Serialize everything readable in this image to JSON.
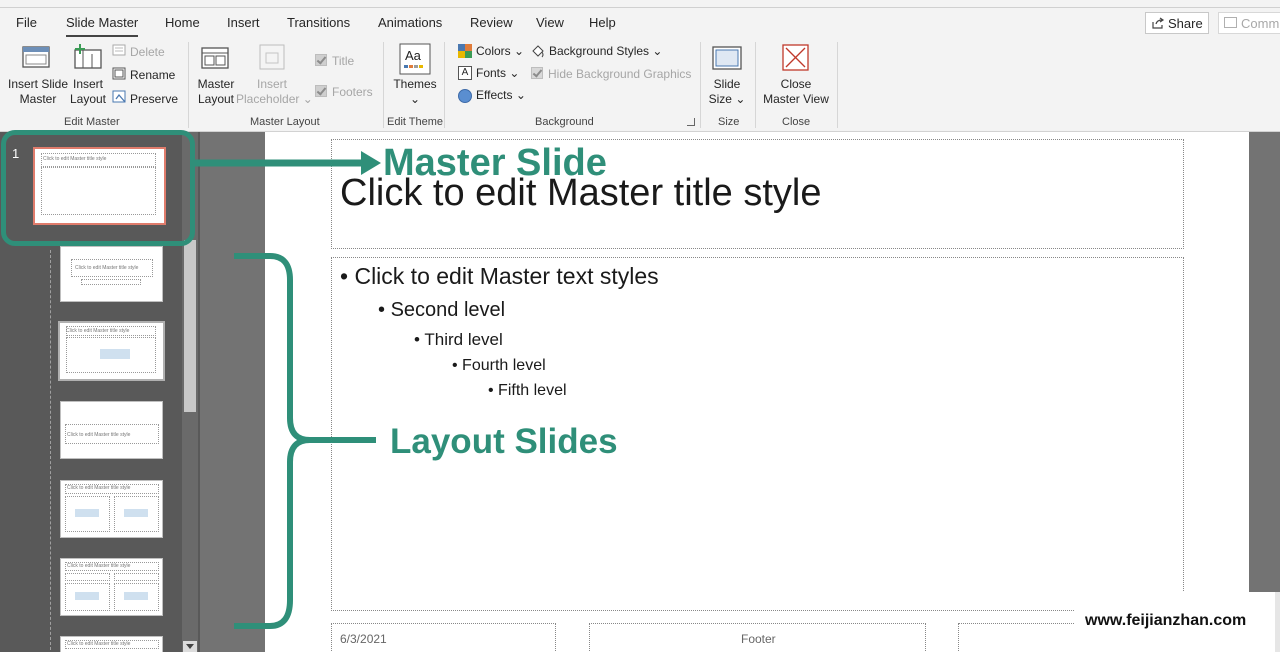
{
  "menu": {
    "tabs": [
      "File",
      "Slide Master",
      "Home",
      "Insert",
      "Transitions",
      "Animations",
      "Review",
      "View",
      "Help"
    ],
    "active_tab": "Slide Master",
    "share_label": "Share",
    "comments_label": "Comm"
  },
  "ribbon": {
    "insert_slide_master": "Insert Slide Master",
    "insert_slide_master_l1": "Insert Slide",
    "insert_slide_master_l2": "Master",
    "insert_layout_l1": "Insert",
    "insert_layout_l2": "Layout",
    "delete": "Delete",
    "rename": "Rename",
    "preserve": "Preserve",
    "group_edit_master": "Edit Master",
    "master_layout_l1": "Master",
    "master_layout_l2": "Layout",
    "insert_placeholder_l1": "Insert",
    "insert_placeholder_l2": "Placeholder",
    "title_check": "Title",
    "footers_check": "Footers",
    "group_master_layout": "Master Layout",
    "themes": "Themes",
    "group_edit_theme": "Edit Theme",
    "colors": "Colors",
    "fonts": "Fonts",
    "effects": "Effects",
    "background_styles": "Background Styles",
    "hide_background_graphics": "Hide Background Graphics",
    "group_background": "Background",
    "slide_size_l1": "Slide",
    "slide_size_l2": "Size",
    "group_size": "Size",
    "close_master_view_l1": "Close",
    "close_master_view_l2": "Master View",
    "group_close": "Close"
  },
  "panel": {
    "slide_number": "1",
    "thumbnail_title": "Click to edit Master title style"
  },
  "slide": {
    "title": "Click to edit Master title style",
    "bullets": [
      "Click to edit Master text styles",
      "Second level",
      "Third level",
      "Fourth level",
      "Fifth level"
    ],
    "footer_date": "6/3/2021",
    "footer_text": "Footer"
  },
  "annotations": {
    "master_slide": "Master Slide",
    "layout_slides": "Layout Slides",
    "accent_color": "#2f8f79"
  },
  "watermark": "www.feijianzhan.com"
}
